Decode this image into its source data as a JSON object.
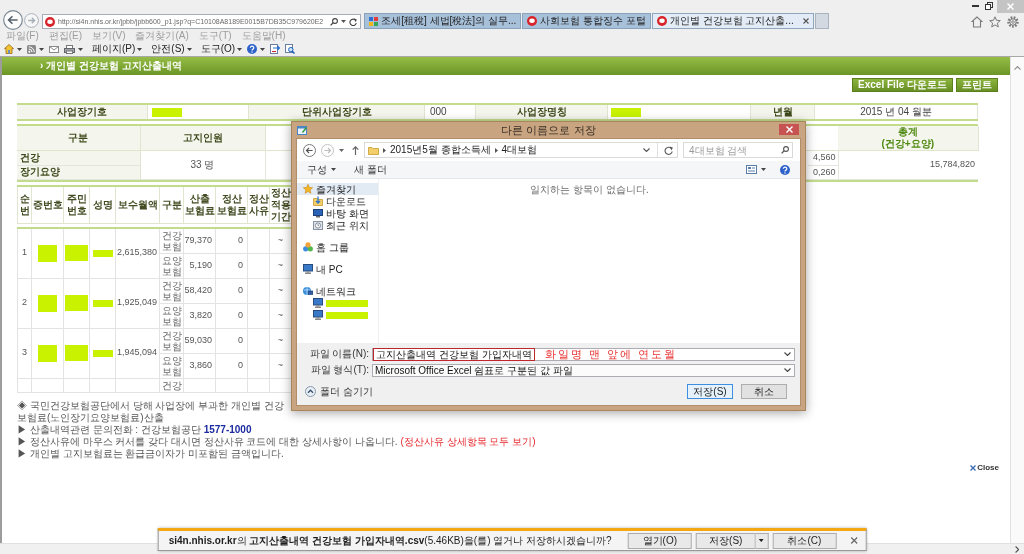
{
  "browser": {
    "url": "http://si4n.nhis.or.kr/jpbb/jpbb600_p1.jsp?q=C10108A8189E0015B7DB35C979620E2",
    "tabs": [
      {
        "kind": "grid",
        "title": "조세[租稅] 세법[稅法]의 실무...",
        "selected": false
      },
      {
        "kind": "circle",
        "title": "사회보험 통합징수 포털",
        "selected": false
      },
      {
        "kind": "circle",
        "title": "개인별 건강보험 고지산출...",
        "selected": true
      }
    ],
    "menu": [
      "파일(F)",
      "편집(E)",
      "보기(V)",
      "즐겨찾기(A)",
      "도구(T)",
      "도움말(H)"
    ],
    "command_bar": [
      {
        "kind": "home",
        "dropdown": true
      },
      {
        "kind": "feed",
        "dropdown": true
      },
      {
        "kind": "mail",
        "dropdown": false
      },
      {
        "kind": "print",
        "dropdown": true
      },
      {
        "kind": "text",
        "label": "페이지(P)",
        "dropdown": true
      },
      {
        "kind": "text",
        "label": "안전(S)",
        "dropdown": true
      },
      {
        "kind": "text",
        "label": "도구(O)",
        "dropdown": true
      },
      {
        "kind": "help",
        "dropdown": true
      },
      {
        "kind": "arrows",
        "dropdown": false
      },
      {
        "kind": "lookup",
        "dropdown": false
      }
    ]
  },
  "page": {
    "title": "› 개인별 건강보험 고지산출내역",
    "buttons": [
      "Excel File 다운로드",
      "프린트"
    ],
    "info": [
      {
        "label": "사업장기호",
        "value": {
          "redacted": true
        }
      },
      {
        "label": "단위사업장기호",
        "value": {
          "text": "000"
        }
      },
      {
        "label": "사업장명칭",
        "value": {
          "redacted": true
        }
      },
      {
        "label": "년월",
        "value": {
          "text": "2015 년 04 월분"
        }
      }
    ],
    "summary": {
      "columns": {
        "category": "구분",
        "headcount": "고지인원",
        "total": "총계\n(건강+요양)"
      },
      "rows": [
        {
          "label": "건강",
          "column_3": "4,560"
        },
        {
          "label": "장기요양",
          "column_3": "0,260"
        }
      ],
      "headcount": "33 명",
      "total": "15,784,820"
    },
    "detail": {
      "columns": [
        "순\n번",
        "증번호",
        "주민\n번호",
        "성명",
        "보수월액",
        "구분",
        "산출\n보험료",
        "정산\n보험료",
        "정산\n사유",
        "정산\n적용\n기간"
      ],
      "rows": [
        {
          "no": "1",
          "card_no": {
            "redacted": true
          },
          "resident_no": {
            "redacted": true
          },
          "name": {
            "redacted": true
          },
          "monthly_pay": "2,615,380",
          "lines": [
            {
              "type": "건강\n보험",
              "assessed": "79,370",
              "adjusted": "0",
              "period": "~"
            },
            {
              "type": "요양\n보험",
              "assessed": "5,190",
              "adjusted": "0",
              "period": "~"
            }
          ]
        },
        {
          "no": "2",
          "card_no": {
            "redacted": true
          },
          "resident_no": {
            "redacted": true
          },
          "name": {
            "redacted": true
          },
          "monthly_pay": "1,925,049",
          "lines": [
            {
              "type": "건강\n보험",
              "assessed": "58,420",
              "adjusted": "0",
              "period": "~"
            },
            {
              "type": "요양\n보험",
              "assessed": "3,820",
              "adjusted": "0",
              "period": "~"
            }
          ]
        },
        {
          "no": "3",
          "card_no": {
            "redacted": true
          },
          "resident_no": {
            "redacted": true
          },
          "name": {
            "redacted": true
          },
          "monthly_pay": "1,945,094",
          "lines": [
            {
              "type": "건강\n보험",
              "assessed": "59,030",
              "adjusted": "0",
              "period": "~"
            },
            {
              "type": "요양\n보험",
              "assessed": "3,860",
              "adjusted": "0",
              "period": "~"
            }
          ]
        },
        {
          "lines": [
            {
              "type": "건강"
            }
          ]
        }
      ]
    },
    "notes": [
      {
        "text": "◈ 국민건강보험공단에서 당해 사업장에 부과한 개인별 건강보험료(노인장기요양보험료)산출"
      },
      {
        "text": "▶ 산출내역관련 문의전화 : 건강보험공단 **1577-1000**"
      },
      {
        "text": "▶ 정산사유에 마우스 커서를 갖다 대시면 정산사유 코드에 대한 상세사항이 나옵니다.",
        "link": "(정산사유 상세항목 모두 보기)"
      },
      {
        "text": "▶ 개인별 고지보험료는 환급금이자가 미포함된 금액입니다."
      }
    ],
    "close_link": "Close"
  },
  "dialog": {
    "title": "다른 이름으로 저장",
    "path": [
      "2015년5월 종합소득세",
      "4대보험"
    ],
    "search_placeholder": "4대보험 검색",
    "toolbar": [
      {
        "label": "구성",
        "dropdown": true
      },
      {
        "label": "새 폴더",
        "dropdown": false
      }
    ],
    "nav": [
      {
        "kind": "favorites",
        "label": "즐겨찾기",
        "selected": true,
        "children": [
          {
            "kind": "downloads",
            "label": "다운로드",
            "selected": false
          },
          {
            "kind": "desktop",
            "label": "바탕 화면",
            "selected": false
          },
          {
            "kind": "recent",
            "label": "최근 위치",
            "selected": false
          }
        ]
      },
      {
        "kind": "homegroup",
        "label": "홈 그룹",
        "selected": false
      },
      {
        "kind": "pc",
        "label": "내 PC",
        "selected": false
      },
      {
        "kind": "network",
        "label": "네트워크",
        "selected": false,
        "children": [
          {
            "kind": "computer",
            "redacted": true,
            "selected": false
          },
          {
            "kind": "computer",
            "redacted": true,
            "selected": false
          }
        ]
      }
    ],
    "empty_message": "일치하는 항목이 없습니다.",
    "file_name": {
      "label": "파일 이름(N):",
      "value": "고지산출내역 건강보험 가입자내역",
      "highlighted": true
    },
    "annotation": "화일명 맨 앞에 연도월",
    "file_type": {
      "label": "파일 형식(T):",
      "value": "Microsoft Office Excel 쉼표로 구분된 값 파일"
    },
    "hide_folders": "폴더 숨기기",
    "buttons": [
      {
        "label": "저장(S)",
        "default": true
      },
      {
        "label": "취소",
        "default": false
      }
    ]
  },
  "download_bar": {
    "message": "**si4n.nhis.or.kr**의 **고지산출내역 건강보험 가입자내역.csv**(5.46KB)을(를) 열거나 저장하시겠습니까?",
    "buttons": [
      {
        "label": "열기(O)",
        "kind": "plain"
      },
      {
        "label": "저장(S)",
        "kind": "split"
      },
      {
        "label": "취소(C)",
        "kind": "plain"
      }
    ]
  }
}
